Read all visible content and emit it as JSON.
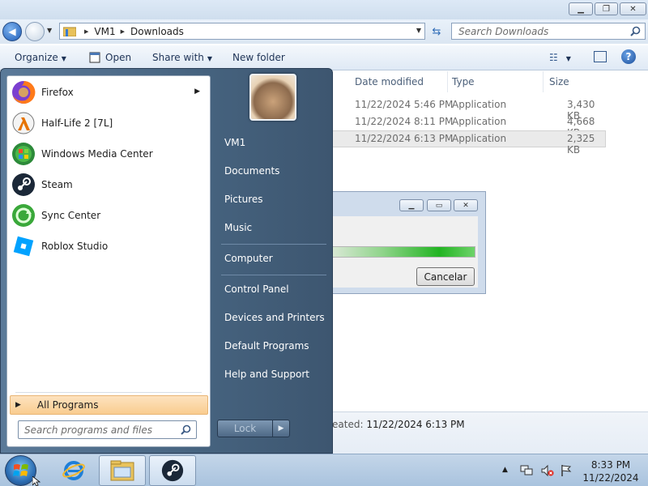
{
  "explorer": {
    "breadcrumb": [
      "VM1",
      "Downloads"
    ],
    "search_placeholder": "Search Downloads",
    "toolbar": {
      "organize": "Organize",
      "open": "Open",
      "share_with": "Share with",
      "new_folder": "New folder"
    },
    "columns": [
      "Date modified",
      "Type",
      "Size"
    ],
    "rows": [
      {
        "date": "11/22/2024 5:46 PM",
        "type": "Application",
        "size": "3,430 KB",
        "selected": false
      },
      {
        "date": "11/22/2024 8:11 PM",
        "type": "Application",
        "size": "4,668 KB",
        "selected": false
      },
      {
        "date": "11/22/2024 6:13 PM",
        "type": "Application",
        "size": "2,325 KB",
        "selected": true
      }
    ],
    "details": {
      "label": "eated:",
      "value": "11/22/2024 6:13 PM"
    }
  },
  "dialog": {
    "progress": 1.0,
    "cancel_label": "Cancelar"
  },
  "start_menu": {
    "programs": [
      {
        "label": "Firefox",
        "icon": "firefox-icon",
        "has_submenu": true
      },
      {
        "label": "Half-Life 2 [7L]",
        "icon": "half-life-icon",
        "has_submenu": false
      },
      {
        "label": "Windows Media Center",
        "icon": "media-center-icon",
        "has_submenu": false
      },
      {
        "label": "Steam",
        "icon": "steam-icon",
        "has_submenu": false
      },
      {
        "label": "Sync Center",
        "icon": "sync-center-icon",
        "has_submenu": false
      },
      {
        "label": "Roblox Studio",
        "icon": "roblox-studio-icon",
        "has_submenu": false
      }
    ],
    "all_programs": "All Programs",
    "search_placeholder": "Search programs and files",
    "right_links": [
      "VM1",
      "Documents",
      "Pictures",
      "Music",
      "Computer",
      "Control Panel",
      "Devices and Printers",
      "Default Programs",
      "Help and Support"
    ],
    "shutdown_label": "Lock"
  },
  "taskbar": {
    "time": "8:33 PM",
    "date": "11/22/2024",
    "pinned": [
      "internet-explorer-icon",
      "file-explorer-icon",
      "steam-icon"
    ]
  },
  "colors": {
    "all_programs_highlight": "#f9cc8f",
    "progress_green": "#22b422",
    "start_menu_right": "#46637f"
  }
}
